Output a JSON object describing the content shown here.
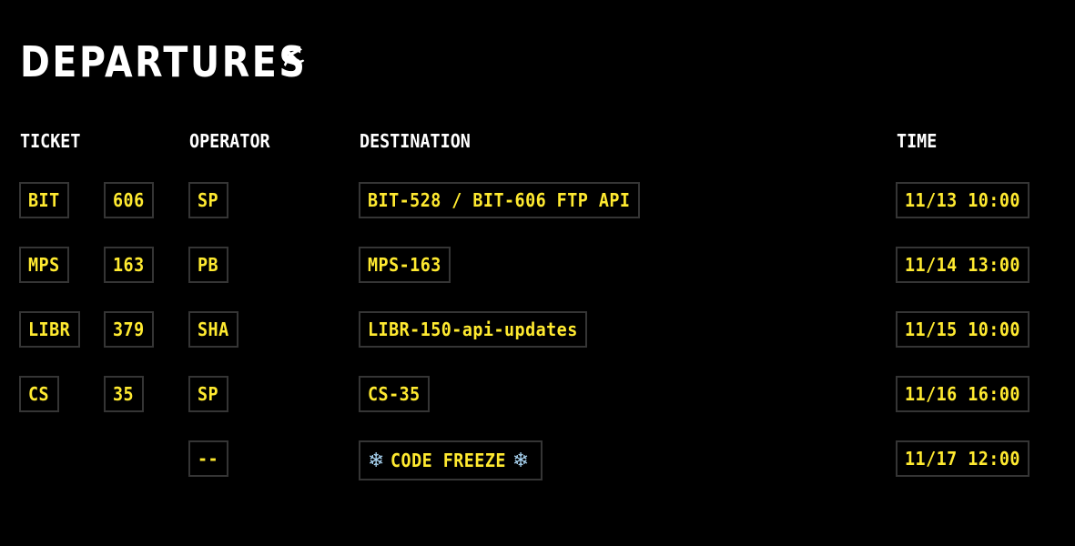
{
  "title": "DEPARTURES",
  "title_icon": "airplane-icon",
  "headers": {
    "ticket": "TICKET",
    "operator": "OPERATOR",
    "destination": "DESTINATION",
    "time": "TIME"
  },
  "rows": [
    {
      "project": "BIT",
      "number": "606",
      "operator": "SP",
      "destination": "BIT-528 / BIT-606 FTP API",
      "time": "11/13 10:00"
    },
    {
      "project": "MPS",
      "number": "163",
      "operator": "PB",
      "destination": "MPS-163",
      "time": "11/14 13:00"
    },
    {
      "project": "LIBR",
      "number": "379",
      "operator": "SHA",
      "destination": "LIBR-150-api-updates",
      "time": "11/15 10:00"
    },
    {
      "project": "CS",
      "number": "35",
      "operator": "SP",
      "destination": "CS-35",
      "time": "11/16 16:00"
    }
  ],
  "freeze_row": {
    "operator": "--",
    "destination": "CODE FREEZE",
    "icon_left": "snowflake-icon",
    "icon_right": "snowflake-icon",
    "snow_glyph": "❄",
    "time": "11/17 12:00"
  },
  "colors": {
    "background": "#000000",
    "text_heading": "#ffffff",
    "text_value": "#ffea30",
    "box_border": "#353535",
    "snowflake": "#a9d4f2"
  }
}
